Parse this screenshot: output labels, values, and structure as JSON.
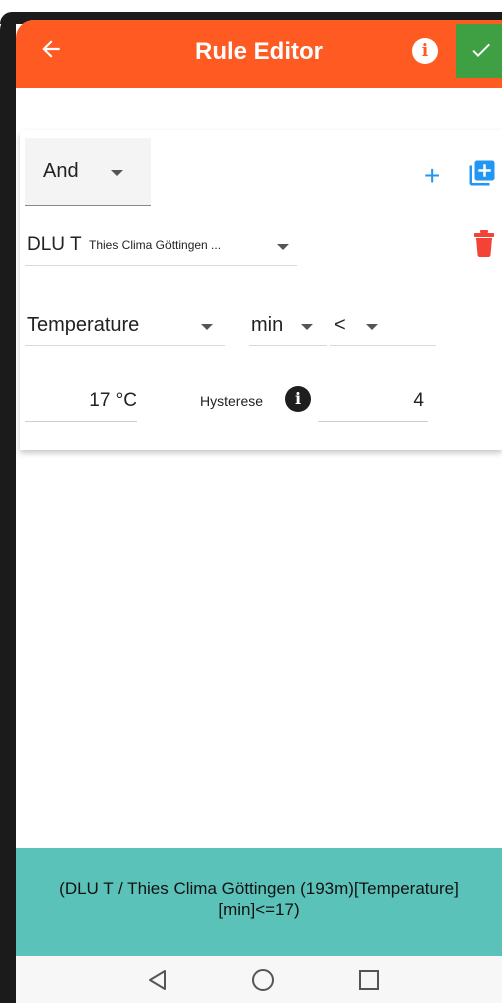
{
  "app_bar": {
    "title": "Rule Editor",
    "back_icon": "arrow-left-icon",
    "info_icon": "info-icon",
    "confirm_icon": "check-icon",
    "color": "#ff5a22",
    "confirm_color": "#3ea043"
  },
  "rule": {
    "logic_operator": "And",
    "sensor": {
      "name": "DLU T",
      "location": "Thies Clima Göttingen ..."
    },
    "measurement": "Temperature",
    "aggregation": "min",
    "comparator": "<",
    "threshold": "17 °C",
    "hysteresis": {
      "label": "Hysterese",
      "value": "4"
    },
    "actions": {
      "add_icon": "plus-icon",
      "add_group_icon": "add-group-icon",
      "delete_icon": "trash-icon"
    }
  },
  "summary": {
    "line1": "(DLU T / Thies Clima Göttingen (193m)[Temperature]",
    "line2": "[min]<=17)",
    "color": "#5bc2b9"
  },
  "nav": {
    "back_icon": "nav-back-icon",
    "home_icon": "nav-home-icon",
    "recent_icon": "nav-recent-icon"
  }
}
